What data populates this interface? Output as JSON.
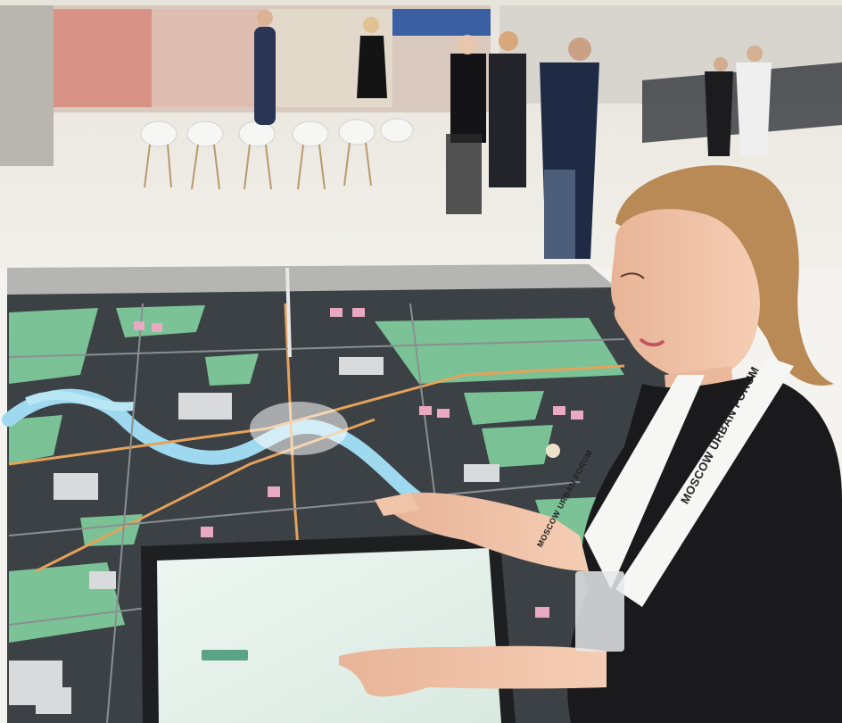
{
  "scene": {
    "lanyard_left_text": "MOSCOW URBAN FORUM",
    "lanyard_right_text": "MOSCOW URBAN FORUM",
    "screen_title_line1": "",
    "screen_title_line2": "",
    "screen_button_label": ""
  },
  "colors": {
    "floor": "#ece9e2",
    "wall": "#c9c6c0",
    "map_base": "#3c4145",
    "park_green": "#7ec99b",
    "river_blue": "#9fd9ef",
    "building_pink": "#e9a9c0",
    "road_orange": "#e5a25a",
    "screen": "#e8f1ec",
    "dress": "#1a1a1c",
    "hair": "#b98a56",
    "skin": "#f0c4a8"
  }
}
